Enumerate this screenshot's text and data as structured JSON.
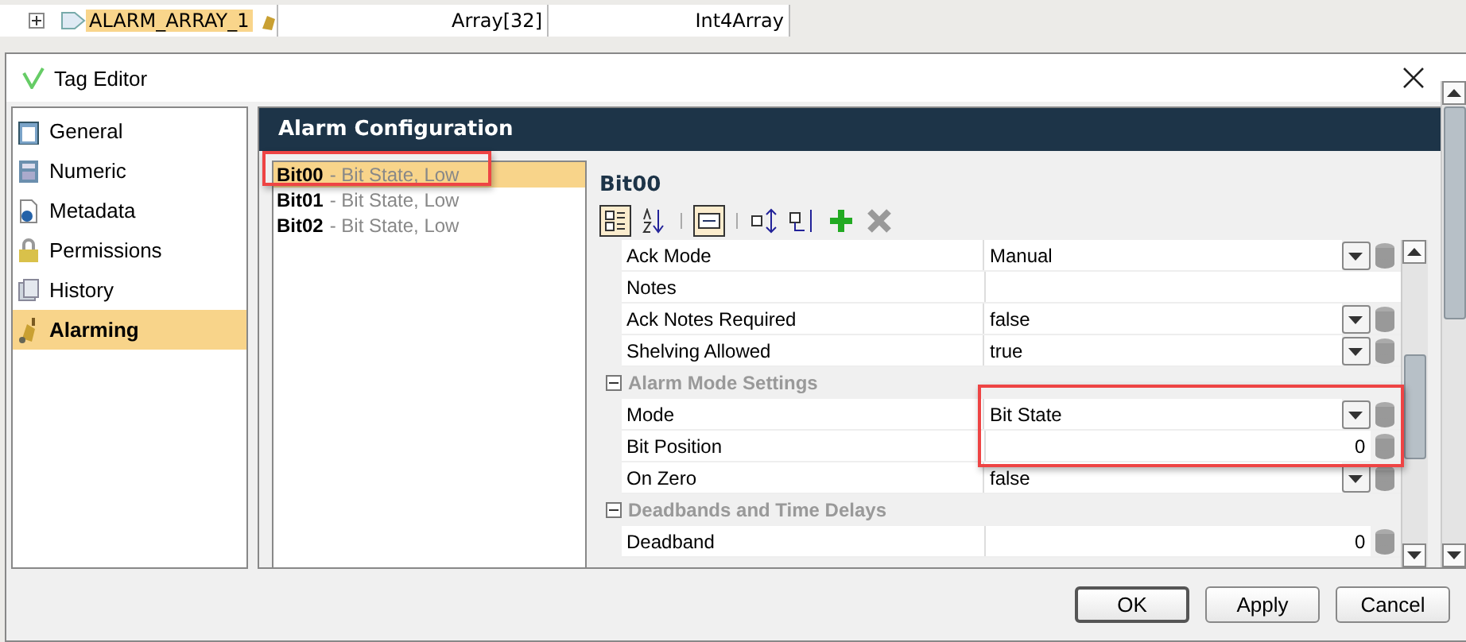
{
  "background_tree": {
    "rows": [
      {
        "name": "ALARM_ARRAY_1",
        "selected": true,
        "value": "Array[32]",
        "type": "Int4Array"
      }
    ]
  },
  "window": {
    "title": "Tag Editor"
  },
  "nav": {
    "items": [
      {
        "label": "General",
        "selected": false
      },
      {
        "label": "Numeric",
        "selected": false
      },
      {
        "label": "Metadata",
        "selected": false
      },
      {
        "label": "Permissions",
        "selected": false
      },
      {
        "label": "History",
        "selected": false
      },
      {
        "label": "Alarming",
        "selected": true
      }
    ]
  },
  "panel": {
    "title": "Alarm Configuration"
  },
  "alarms": [
    {
      "name": "Bit00",
      "detail": "- Bit State, Low",
      "selected": true
    },
    {
      "name": "Bit01",
      "detail": "- Bit State, Low",
      "selected": false
    },
    {
      "name": "Bit02",
      "detail": "- Bit State, Low",
      "selected": false
    }
  ],
  "editor": {
    "title": "Bit00",
    "properties": [
      {
        "kind": "select",
        "name": "Ack Mode",
        "value": "Manual"
      },
      {
        "kind": "text",
        "name": "Notes"
      },
      {
        "kind": "select",
        "name": "Ack Notes Required",
        "value": "false"
      },
      {
        "kind": "select",
        "name": "Shelving Allowed",
        "value": "true"
      },
      {
        "kind": "section",
        "name": "Alarm Mode Settings",
        "expanded": true
      },
      {
        "kind": "select",
        "name": "Mode",
        "value": "Bit State"
      },
      {
        "kind": "number",
        "name": "Bit Position",
        "value": "0"
      },
      {
        "kind": "select",
        "name": "On Zero",
        "value": "false"
      },
      {
        "kind": "section",
        "name": "Deadbands and Time Delays",
        "expanded": true
      },
      {
        "kind": "number",
        "name": "Deadband",
        "value": "0"
      }
    ]
  },
  "buttons": [
    {
      "label": "OK",
      "default": true
    },
    {
      "label": "Apply",
      "default": false
    },
    {
      "label": "Cancel",
      "default": false
    }
  ]
}
